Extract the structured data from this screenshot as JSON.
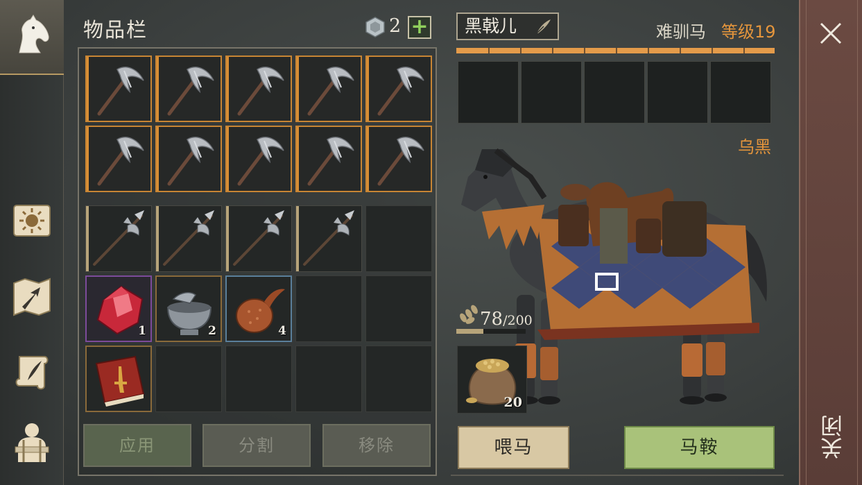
{
  "left_nav": {
    "items": [
      {
        "name": "horse-tab-icon",
        "active": true
      },
      {
        "name": "sun-scroll-icon",
        "active": false
      },
      {
        "name": "map-arrow-icon",
        "active": false
      },
      {
        "name": "quest-scroll-icon",
        "active": false
      },
      {
        "name": "backpack-character-icon",
        "active": false
      }
    ]
  },
  "inventory": {
    "title": "物品栏",
    "currency_count": "2",
    "add_label": "+",
    "rows": [
      [
        {
          "item": "pickaxe-icon",
          "rarity": "orange"
        },
        {
          "item": "pickaxe-icon",
          "rarity": "orange"
        },
        {
          "item": "pickaxe-icon",
          "rarity": "orange"
        },
        {
          "item": "pickaxe-icon",
          "rarity": "orange"
        },
        {
          "item": "pickaxe-icon",
          "rarity": "orange"
        }
      ],
      [
        {
          "item": "pickaxe-icon",
          "rarity": "orange"
        },
        {
          "item": "pickaxe-icon",
          "rarity": "orange"
        },
        {
          "item": "pickaxe-icon",
          "rarity": "orange"
        },
        {
          "item": "pickaxe-icon",
          "rarity": "orange"
        },
        {
          "item": "pickaxe-icon",
          "rarity": "orange"
        }
      ],
      [
        {
          "item": "halberd-icon",
          "rarity": "tan"
        },
        {
          "item": "halberd-icon",
          "rarity": "tan"
        },
        {
          "item": "halberd-icon",
          "rarity": "tan"
        },
        {
          "item": "halberd-icon",
          "rarity": "tan"
        },
        {
          "item": null
        }
      ],
      [
        {
          "item": "red-crystal-icon",
          "rarity": "purple",
          "qty": "1"
        },
        {
          "item": "mortar-pestle-icon",
          "rarity": "amber",
          "qty": "2"
        },
        {
          "item": "gourd-seed-icon",
          "rarity": "blue",
          "qty": "4"
        },
        {
          "item": null
        },
        {
          "item": null
        }
      ],
      [
        {
          "item": "red-book-icon",
          "rarity": "amber"
        },
        {
          "item": null
        },
        {
          "item": null
        },
        {
          "item": null
        },
        {
          "item": null
        }
      ]
    ],
    "buttons": {
      "apply": "应用",
      "split": "分割",
      "remove": "移除"
    }
  },
  "horse": {
    "name": "黑戟儿",
    "breed": "难驯马",
    "level": "等级19",
    "color": "乌黑",
    "food_current": "78",
    "food_max": "/200",
    "food_fraction": 0.39,
    "food_item_qty": "20",
    "feed_label": "喂马",
    "saddle_label": "马鞍",
    "equip_slots": 5
  },
  "close": {
    "label": "关闭"
  },
  "colors": {
    "orange_accent": "#e4953c",
    "green_button": "#a9c27a",
    "close_panel": "#6b4a42"
  }
}
